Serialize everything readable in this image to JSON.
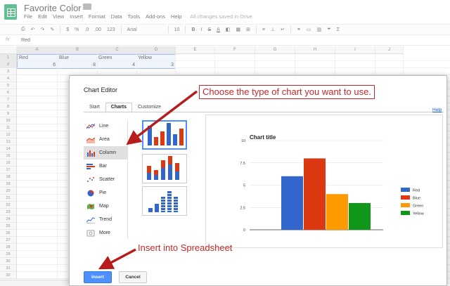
{
  "app": {
    "title": "Favorite Color",
    "menu": [
      "File",
      "Edit",
      "View",
      "Insert",
      "Format",
      "Data",
      "Tools",
      "Add-ons",
      "Help"
    ],
    "saved_status": "All changes saved in Drive"
  },
  "toolbar": {
    "percent": "%",
    "decimal_less": ".0",
    "decimal_more": ".00",
    "more_formats": "123",
    "font": "Arial",
    "font_size": "10",
    "bold": "B",
    "italic": "I",
    "strike": "S",
    "text_color": "A",
    "currency": "$",
    "sigma": "Σ"
  },
  "formula_bar": {
    "fx": "fx",
    "value": "Red"
  },
  "sheet": {
    "columns": [
      "A",
      "B",
      "C",
      "D",
      "E",
      "F",
      "G",
      "H",
      "I",
      "J"
    ],
    "rows": [
      "1",
      "2",
      "3",
      "4",
      "5",
      "6",
      "7",
      "8",
      "9",
      "10",
      "11",
      "12",
      "13",
      "14",
      "15",
      "16",
      "17",
      "18",
      "19",
      "20",
      "21",
      "22",
      "23",
      "24",
      "25",
      "26",
      "27",
      "28",
      "29",
      "30",
      "31",
      "32"
    ],
    "header_cells": [
      "Red",
      "Blue",
      "Green",
      "Yellow"
    ],
    "value_cells": [
      "6",
      "8",
      "4",
      "3"
    ]
  },
  "dialog": {
    "title": "Chart Editor",
    "tabs": [
      "Start",
      "Charts",
      "Customize"
    ],
    "active_tab": "Charts",
    "help": "Help",
    "chart_types": [
      {
        "label": "Line",
        "icon": "line-chart-icon"
      },
      {
        "label": "Area",
        "icon": "area-chart-icon"
      },
      {
        "label": "Column",
        "icon": "column-chart-icon"
      },
      {
        "label": "Bar",
        "icon": "bar-chart-icon"
      },
      {
        "label": "Scatter",
        "icon": "scatter-chart-icon"
      },
      {
        "label": "Pie",
        "icon": "pie-chart-icon"
      },
      {
        "label": "Map",
        "icon": "map-chart-icon"
      },
      {
        "label": "Trend",
        "icon": "trend-chart-icon"
      },
      {
        "label": "More",
        "icon": "more-chart-icon"
      }
    ],
    "selected_type": "Column",
    "insert_label": "Insert",
    "cancel_label": "Cancel"
  },
  "chart_data": {
    "type": "bar",
    "title": "Chart title",
    "categories": [
      "Red",
      "Blue",
      "Green",
      "Yellow"
    ],
    "values": [
      6,
      8,
      4,
      3
    ],
    "colors": [
      "#3366cc",
      "#dc3912",
      "#ff9900",
      "#109618"
    ],
    "ylim": [
      0,
      10
    ],
    "yticks": [
      "0",
      "2.5",
      "5",
      "7.5",
      "10"
    ],
    "legend": "right",
    "grid": true
  },
  "annotations": {
    "choose": "Choose the type of chart you want to use.",
    "insert": "Insert into Spreadsheet",
    "color": "#c62828"
  }
}
